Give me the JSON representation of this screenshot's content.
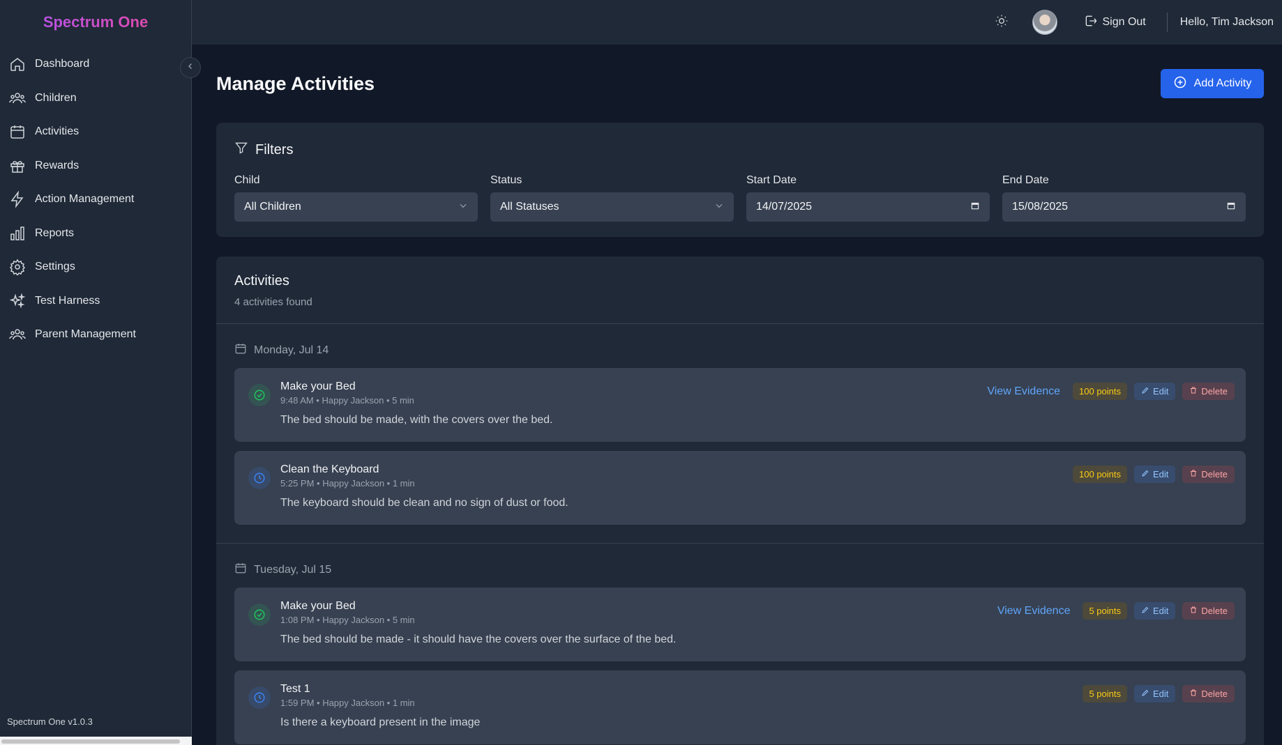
{
  "app": {
    "brand": "Spectrum One",
    "version": "Spectrum One v1.0.3"
  },
  "sidebar": {
    "items": [
      {
        "label": "Dashboard",
        "icon": "home-icon"
      },
      {
        "label": "Children",
        "icon": "users-icon"
      },
      {
        "label": "Activities",
        "icon": "calendar-icon"
      },
      {
        "label": "Rewards",
        "icon": "gift-icon"
      },
      {
        "label": "Action Management",
        "icon": "lightning-icon"
      },
      {
        "label": "Reports",
        "icon": "bar-chart-icon"
      },
      {
        "label": "Settings",
        "icon": "gear-icon"
      },
      {
        "label": "Test Harness",
        "icon": "sparkles-icon"
      },
      {
        "label": "Parent Management",
        "icon": "users-icon"
      }
    ]
  },
  "header": {
    "signout": "Sign Out",
    "greeting": "Hello, Tim Jackson"
  },
  "page": {
    "title": "Manage Activities",
    "add_button": "Add Activity"
  },
  "filters": {
    "title": "Filters",
    "child": {
      "label": "Child",
      "value": "All Children"
    },
    "status": {
      "label": "Status",
      "value": "All Statuses"
    },
    "start": {
      "label": "Start Date",
      "value": "14/07/2025"
    },
    "end": {
      "label": "End Date",
      "value": "15/08/2025"
    }
  },
  "activities": {
    "title": "Activities",
    "count": "4 activities found",
    "groups": [
      {
        "date": "Monday, Jul 14",
        "items": [
          {
            "title": "Make your Bed",
            "meta": "9:48 AM • Happy Jackson • 5 min",
            "desc": "The bed should be made, with the covers over the bed.",
            "status": "completed",
            "evidence": "View Evidence",
            "points": "100 points",
            "edit": "Edit",
            "delete": "Delete"
          },
          {
            "title": "Clean the Keyboard",
            "meta": "5:25 PM • Happy Jackson • 1 min",
            "desc": "The keyboard should be clean and no sign of dust or food.",
            "status": "pending",
            "points": "100 points",
            "edit": "Edit",
            "delete": "Delete"
          }
        ]
      },
      {
        "date": "Tuesday, Jul 15",
        "items": [
          {
            "title": "Make your Bed",
            "meta": "1:08 PM • Happy Jackson • 5 min",
            "desc": "The bed should be made - it should have the covers over the surface of the bed.",
            "status": "completed",
            "evidence": "View Evidence",
            "points": "5 points",
            "edit": "Edit",
            "delete": "Delete"
          },
          {
            "title": "Test 1",
            "meta": "1:59 PM • Happy Jackson • 1 min",
            "desc": "Is there a keyboard present in the image",
            "status": "pending",
            "points": "5 points",
            "edit": "Edit",
            "delete": "Delete"
          }
        ]
      }
    ]
  },
  "colors": {
    "accent": "#2563eb",
    "brand_from": "#a855f7",
    "brand_to": "#ec4899",
    "completed": "#22c55e",
    "pending": "#3b82f6"
  }
}
